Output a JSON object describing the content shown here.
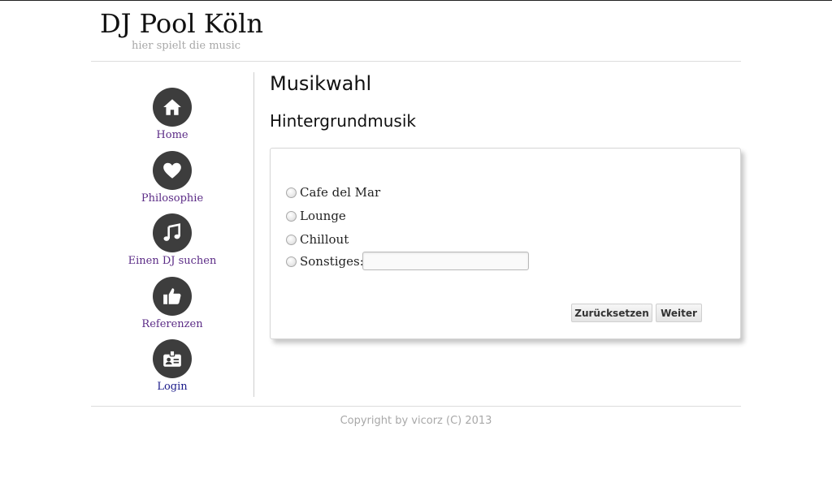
{
  "header": {
    "title": "DJ Pool Köln",
    "tagline": "hier spielt die music"
  },
  "nav": {
    "items": [
      {
        "label": "Home",
        "icon": "home-icon"
      },
      {
        "label": "Philosophie",
        "icon": "heart-icon"
      },
      {
        "label": "Einen DJ suchen",
        "icon": "music-note-icon"
      },
      {
        "label": "Referenzen",
        "icon": "thumbs-up-icon"
      },
      {
        "label": "Login",
        "icon": "id-badge-icon"
      }
    ]
  },
  "main": {
    "title": "Musikwahl",
    "subtitle": "Hintergrundmusik",
    "options": [
      {
        "label": "Cafe del Mar",
        "selected": false
      },
      {
        "label": "Lounge",
        "selected": false
      },
      {
        "label": "Chillout",
        "selected": false
      },
      {
        "label": "Sonstiges:",
        "selected": false
      }
    ],
    "other_input_value": "",
    "reset_label": "Zurücksetzen",
    "next_label": "Weiter"
  },
  "footer": {
    "copyright": "Copyright by vicorz (C) 2013"
  },
  "colors": {
    "nav_link": "#5b2b86",
    "login_link": "#1b1b8a",
    "icon_circle": "#3d3d3d"
  }
}
